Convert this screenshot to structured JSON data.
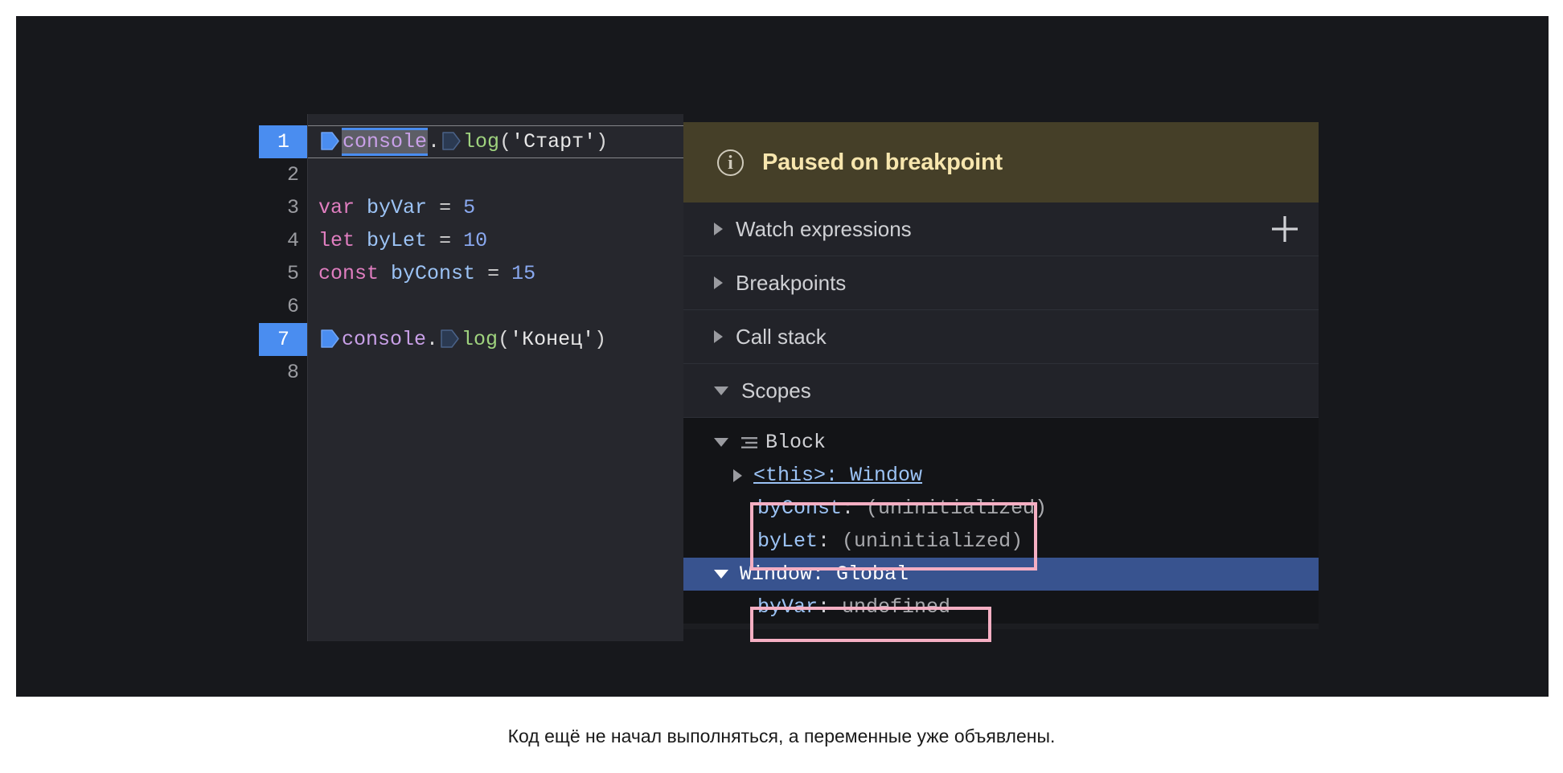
{
  "editor": {
    "lines": [
      {
        "number": "1",
        "breakpoint": true,
        "current": true,
        "tokens": [
          {
            "type": "pentagon-selected",
            "text": ""
          },
          {
            "type": "obj-selected",
            "text": "console"
          },
          {
            "type": "punct",
            "text": "."
          },
          {
            "type": "pentagon-plain",
            "text": ""
          },
          {
            "type": "fn",
            "text": "log"
          },
          {
            "type": "punct",
            "text": "("
          },
          {
            "type": "str",
            "text": "'Старт'"
          },
          {
            "type": "punct",
            "text": ")"
          }
        ]
      },
      {
        "number": "2",
        "breakpoint": false,
        "current": false,
        "tokens": []
      },
      {
        "number": "3",
        "breakpoint": false,
        "current": false,
        "tokens": [
          {
            "type": "kw",
            "text": "var"
          },
          {
            "type": "plain",
            "text": " "
          },
          {
            "type": "ident",
            "text": "byVar"
          },
          {
            "type": "plain",
            "text": " "
          },
          {
            "type": "op",
            "text": "="
          },
          {
            "type": "plain",
            "text": " "
          },
          {
            "type": "num",
            "text": "5"
          }
        ]
      },
      {
        "number": "4",
        "breakpoint": false,
        "current": false,
        "tokens": [
          {
            "type": "kw",
            "text": "let"
          },
          {
            "type": "plain",
            "text": " "
          },
          {
            "type": "ident",
            "text": "byLet"
          },
          {
            "type": "plain",
            "text": " "
          },
          {
            "type": "op",
            "text": "="
          },
          {
            "type": "plain",
            "text": " "
          },
          {
            "type": "num",
            "text": "10"
          }
        ]
      },
      {
        "number": "5",
        "breakpoint": false,
        "current": false,
        "tokens": [
          {
            "type": "kw",
            "text": "const"
          },
          {
            "type": "plain",
            "text": " "
          },
          {
            "type": "ident",
            "text": "byConst"
          },
          {
            "type": "plain",
            "text": " "
          },
          {
            "type": "op",
            "text": "="
          },
          {
            "type": "plain",
            "text": " "
          },
          {
            "type": "num",
            "text": "15"
          }
        ]
      },
      {
        "number": "6",
        "breakpoint": false,
        "current": false,
        "tokens": []
      },
      {
        "number": "7",
        "breakpoint": true,
        "current": false,
        "tokens": [
          {
            "type": "pentagon-selected",
            "text": ""
          },
          {
            "type": "obj",
            "text": "console"
          },
          {
            "type": "punct",
            "text": "."
          },
          {
            "type": "pentagon-plain",
            "text": ""
          },
          {
            "type": "fn",
            "text": "log"
          },
          {
            "type": "punct",
            "text": "("
          },
          {
            "type": "str",
            "text": "'Конец'"
          },
          {
            "type": "punct",
            "text": ")"
          }
        ]
      },
      {
        "number": "8",
        "breakpoint": false,
        "current": false,
        "tokens": []
      }
    ]
  },
  "debugger": {
    "banner": {
      "icon": "info-circle-icon",
      "text": "Paused on breakpoint"
    },
    "sections": [
      {
        "label": "Watch expressions",
        "expanded": false,
        "has_add": true,
        "add_icon": "plus-icon"
      },
      {
        "label": "Breakpoints",
        "expanded": false,
        "has_add": false
      },
      {
        "label": "Call stack",
        "expanded": false,
        "has_add": false
      },
      {
        "label": "Scopes",
        "expanded": true,
        "has_add": false
      }
    ],
    "scopes": {
      "block": {
        "label": "Block",
        "icon": "block-scope-icon",
        "expanded": true,
        "this_entry": {
          "key": "<this>",
          "sep": ": ",
          "value": "Window"
        },
        "variables": [
          {
            "key": "byConst",
            "sep": ": ",
            "value": "(uninitialized)"
          },
          {
            "key": "byLet",
            "sep": ": ",
            "value": "(uninitialized)"
          }
        ]
      },
      "global": {
        "label": "Window: Global",
        "expanded": true,
        "selected": true,
        "variables": [
          {
            "key": "byVar",
            "sep": ": ",
            "value": "undefined"
          }
        ]
      }
    }
  },
  "annotations": {
    "highlight_color": "#f5afc3",
    "boxes": [
      "block-uninitialized-vars",
      "global-byvar"
    ]
  },
  "caption": {
    "text": "Код ещё не начал выполняться, а переменные уже объявлены."
  },
  "colors": {
    "background": "#17181c",
    "panel": "#1c1d21",
    "banner_bg": "#453f28",
    "banner_text": "#f7e6ae",
    "breakpoint_blue": "#4a8df0",
    "selection_blue": "#38538f",
    "pink": "#f5afc3"
  }
}
